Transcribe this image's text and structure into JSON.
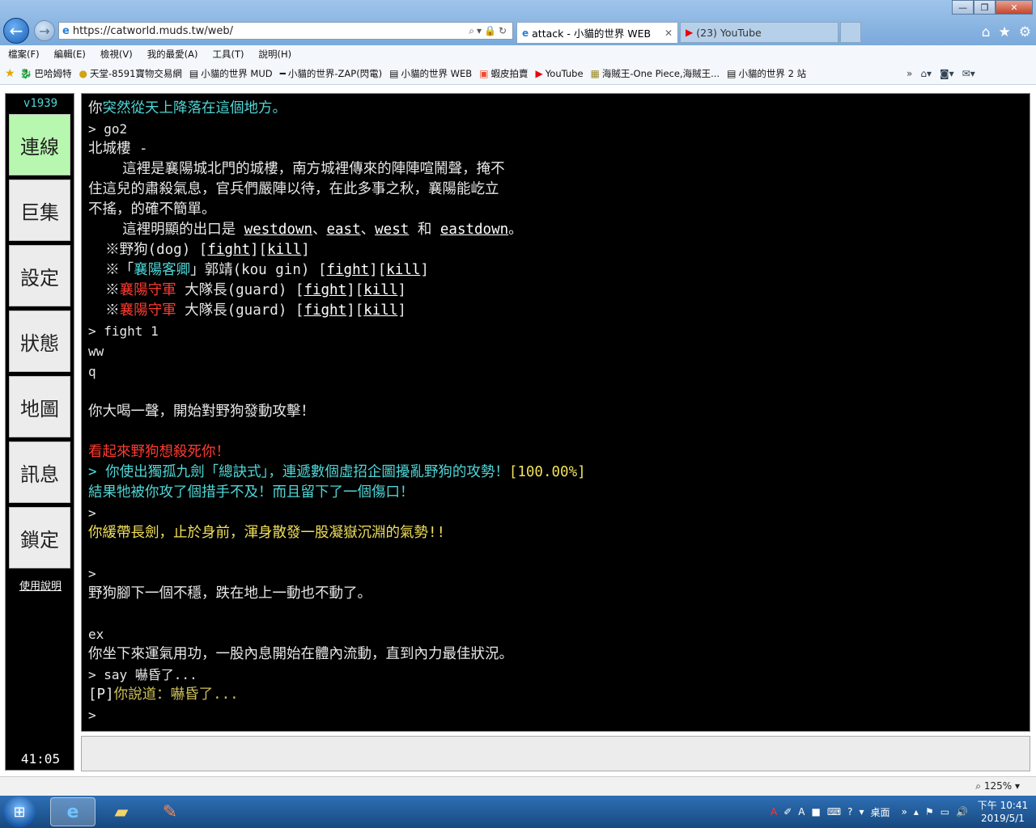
{
  "browser": {
    "url": "https://catworld.muds.tw/web/",
    "tabs": [
      {
        "label": "attack - 小貓的世界 WEB",
        "icon": "ie-icon"
      },
      {
        "label": "(23) YouTube",
        "icon": "youtube-icon"
      }
    ],
    "window_controls": [
      "—",
      "❐",
      "✕"
    ]
  },
  "menu": [
    "檔案(F)",
    "編輯(E)",
    "檢視(V)",
    "我的最愛(A)",
    "工具(T)",
    "說明(H)"
  ],
  "favorites": [
    {
      "label": "巴哈姆特",
      "icon": "dragon-icon"
    },
    {
      "label": "天堂-8591寶物交易網",
      "icon": "coin-icon"
    },
    {
      "label": "小貓的世界 MUD",
      "icon": "page-icon"
    },
    {
      "label": "小貓的世界-ZAP(閃電)",
      "icon": "dash-icon"
    },
    {
      "label": "小貓的世界 WEB",
      "icon": "page-icon"
    },
    {
      "label": "蝦皮拍賣",
      "icon": "shopee-icon"
    },
    {
      "label": "YouTube",
      "icon": "youtube-icon"
    },
    {
      "label": "海賊王-One Piece,海賊王...",
      "icon": "sf-icon"
    },
    {
      "label": "小貓的世界 2 站",
      "icon": "page-icon"
    }
  ],
  "sidebar": {
    "version": "v1939",
    "buttons": [
      "連線",
      "巨集",
      "設定",
      "狀態",
      "地圖",
      "訊息",
      "鎖定"
    ],
    "help": "使用說明",
    "timer": "41:05"
  },
  "terminal": {
    "l1a": "你",
    "l1b": "突然從天上降落在這個地方。",
    "l2": "> go2",
    "l3": "北城樓 -",
    "l4": "    這裡是襄陽城北門的城樓，南方城裡傳來的陣陣喧鬧聲，掩不",
    "l5": "住這兒的肅殺氣息，官兵們嚴陣以待，在此多事之秋，襄陽能屹立",
    "l6": "不搖，的確不簡單。",
    "exits_prefix": "    這裡明顯的出口是 ",
    "exits": [
      "westdown",
      "east",
      "west",
      "eastdown"
    ],
    "sep": "、",
    "and": " 和 ",
    "period": "。",
    "m1": "  ※野狗(dog) ",
    "m2a": "  ※「",
    "m2b": "襄陽客卿",
    "m2c": "」郭靖(kou gin) ",
    "m3a": "  ※",
    "m3b": "襄陽守軍",
    "m3c": " 大隊長(guard) ",
    "fight": "fight",
    "kill": "kill",
    "lb": "[",
    "rb": "]",
    "l7": "> fight 1",
    "l8": "ww",
    "l9": "q",
    "l10": "你大喝一聲，開始對野狗發動攻擊！",
    "l11": "看起來野狗想殺死你！",
    "l12a": "> 你使出獨孤九劍「總訣式」，連遞數個虛招企圖擾亂野狗的攻勢！",
    "l12b": "[100.00%]",
    "l13": "結果牠被你攻了個措手不及！而且留下了一個傷口！",
    "l14": ">",
    "l15": "你緩帶長劍，止於身前，渾身散發一股凝嶽沉淵的氣勢!!",
    "l16": ">",
    "l17": "野狗腳下一個不穩，跌在地上一動也不動了。",
    "l18": "ex",
    "l19": "你坐下來運氣用功，一股內息開始在體內流動，直到內力最佳狀況。",
    "l20": "> say 嚇昏了...",
    "l21a": "[P]",
    "l21b": "你說道：嚇昏了...",
    "l22": ">"
  },
  "status": {
    "zoom": "125%"
  },
  "taskbar": {
    "desktop": "桌面",
    "time": "下午 10:41",
    "date": "2019/5/1"
  },
  "colors": {
    "cyan": "#4fd6d6",
    "red": "#ff3b30",
    "yellow": "#f0e05a",
    "active_button": "#b8f7b0"
  }
}
